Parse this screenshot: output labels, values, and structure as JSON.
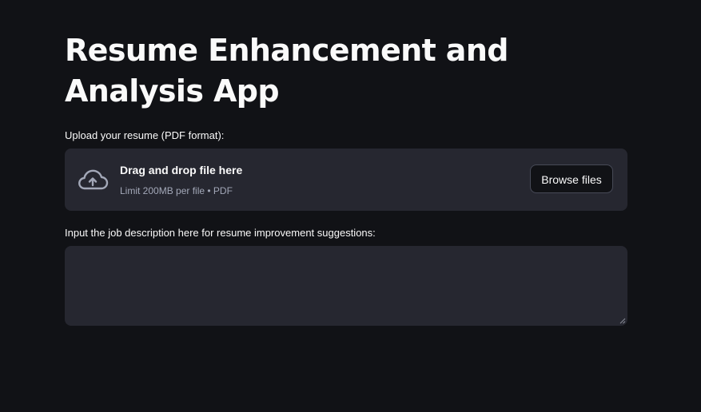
{
  "app": {
    "title": "Resume Enhancement and Analysis App"
  },
  "upload": {
    "label": "Upload your resume (PDF format):",
    "dropzone_title": "Drag and drop file here",
    "dropzone_subtitle": "Limit 200MB per file • PDF",
    "browse_label": "Browse files",
    "icon": "cloud-upload-icon"
  },
  "job_description": {
    "label": "Input the job description here for resume improvement suggestions:",
    "value": "",
    "placeholder": ""
  },
  "colors": {
    "background": "#111216",
    "surface": "#262730",
    "text": "#fafafa",
    "muted_text": "#a3a8b8",
    "button_border": "#474a57"
  }
}
